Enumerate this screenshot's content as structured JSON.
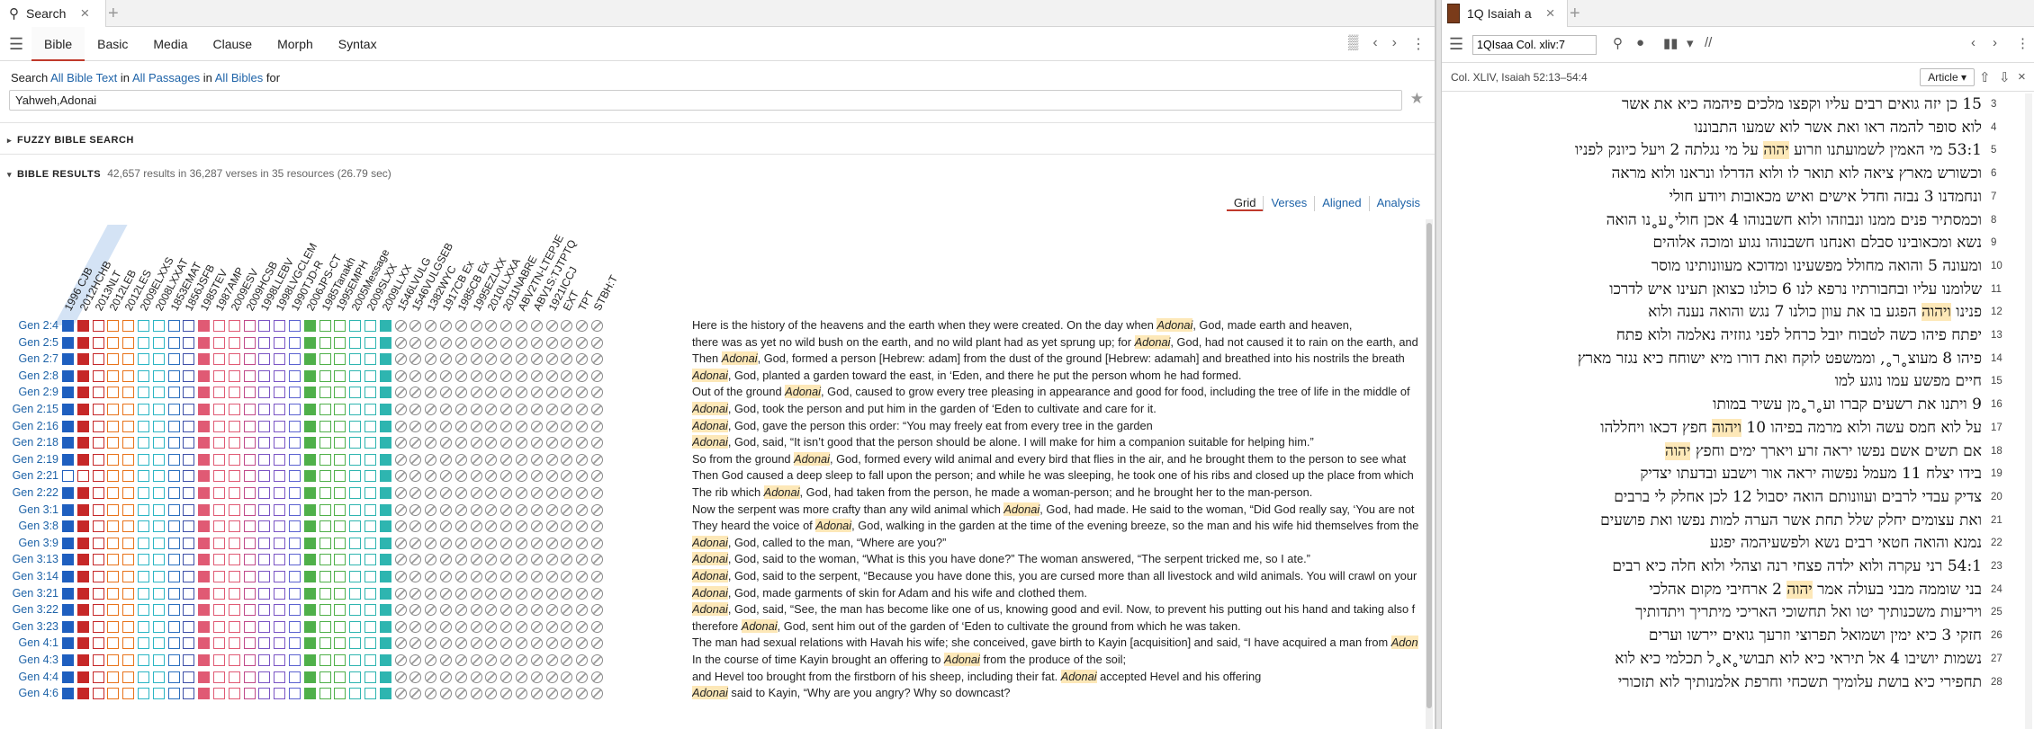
{
  "left_tab": {
    "icon": "search-icon",
    "label": "Search"
  },
  "left_menu": [
    "Bible",
    "Basic",
    "Media",
    "Clause",
    "Morph",
    "Syntax"
  ],
  "search_line": {
    "prefix": "Search",
    "scope1": "All Bible Text",
    "in1": "in",
    "scope2": "All Passages",
    "in2": "in",
    "scope3": "All Bibles",
    "for": "for"
  },
  "query": "Yahweh,Adonai",
  "fuzzy_label": "FUZZY BIBLE SEARCH",
  "results_label": "BIBLE RESULTS",
  "results_meta": "42,657 results in 36,287 verses in 35 resources (26.79 sec)",
  "view_tabs": [
    "Grid",
    "Verses",
    "Aligned",
    "Analysis"
  ],
  "columns": [
    "1996 CJB",
    "2012HCHB",
    "2013NLT",
    "2012LEB",
    "2012LES",
    "2009ELXXS",
    "2008LXXAT",
    "1853EMAT",
    "1856JSFB",
    "1985TEV",
    "1987AMP",
    "2009ESV",
    "2009HCSB",
    "1998LLEBV",
    "1998LVGCLEM",
    "1990TJD-R",
    "2006JPS-CT",
    "1985Tanakh",
    "1995EMPH",
    "2005Message",
    "2009SLXX",
    "2009LLXX",
    "1546LVULG",
    "1546VULGSEB",
    "1382WYC",
    "1917CB Ex",
    "1985CB Ex",
    "1995EZLXX",
    "2010LLXXA",
    "2011NABRE",
    "ABV2TN-LTEPJE",
    "ABV1S:TJTPTQ",
    "1921ICCJ",
    "EXT",
    "TPT",
    "STBH:T"
  ],
  "palette": [
    "#1f5fbf",
    "#c62828",
    "#c62828",
    "#e8731a",
    "#e8731a",
    "#2bb5c4",
    "#2bb5c4",
    "#2a6fbf",
    "#3d4fa8",
    "#e05a74",
    "#e05a74",
    "#e05a74",
    "#c04a8a",
    "#7a55c4",
    "#7a55c4",
    "#5b62d0",
    "#4fb04a",
    "#4fb04a",
    "#4fb04a",
    "#2eb5b0",
    "#2eb5b0",
    "#2eb5b0",
    "#888888",
    "#888888",
    "#888888",
    "#888888",
    "#888888",
    "#888888",
    "#888888",
    "#888888",
    "#888888",
    "#888888",
    "#888888",
    "#888888",
    "#888888",
    "#888888"
  ],
  "rows": [
    {
      "ref": "Gen 2:4",
      "pre": "Here is the history of the heavens and the earth when they were created. On the day when ",
      "hl": "Adonai",
      "post": ", God, made earth and heaven,"
    },
    {
      "ref": "Gen 2:5",
      "pre": "there was as yet no wild bush on the earth, and no wild plant had as yet sprung up; for ",
      "hl": "Adonai",
      "post": ", God, had not caused it to rain on the earth, and"
    },
    {
      "ref": "Gen 2:7",
      "pre": "Then ",
      "hl": "Adonai",
      "post": ", God, formed a person [Hebrew: adam] from the dust of the ground [Hebrew: adamah] and breathed into his nostrils the breath"
    },
    {
      "ref": "Gen 2:8",
      "pre": "",
      "hl": "Adonai",
      "post": ", God, planted a garden toward the east, in ‘Eden, and there he put the person whom he had formed."
    },
    {
      "ref": "Gen 2:9",
      "pre": "Out of the ground ",
      "hl": "Adonai",
      "post": ", God, caused to grow every tree pleasing in appearance and good for food, including the tree of life in the middle of"
    },
    {
      "ref": "Gen 2:15",
      "pre": "",
      "hl": "Adonai",
      "post": ", God, took the person and put him in the garden of ‘Eden to cultivate and care for it."
    },
    {
      "ref": "Gen 2:16",
      "pre": "",
      "hl": "Adonai",
      "post": ", God, gave the person this order: “You may freely eat from every tree in the garden"
    },
    {
      "ref": "Gen 2:18",
      "pre": "",
      "hl": "Adonai",
      "post": ", God, said, “It isn’t good that the person should be alone. I will make for him a companion suitable for helping him.”"
    },
    {
      "ref": "Gen 2:19",
      "pre": "So from the ground ",
      "hl": "Adonai",
      "post": ", God, formed every wild animal and every bird that flies in the air, and he brought them to the person to see what"
    },
    {
      "ref": "Gen 2:21",
      "pre": "Then God caused a deep sleep to fall upon the person; and while he was sleeping, he took one of his ribs and closed up the place from which",
      "hl": "",
      "post": ""
    },
    {
      "ref": "Gen 2:22",
      "pre": "The rib which ",
      "hl": "Adonai",
      "post": ", God, had taken from the person, he made a woman-person; and he brought her to the man-person."
    },
    {
      "ref": "Gen 3:1",
      "pre": "Now the serpent was more crafty than any wild animal which ",
      "hl": "Adonai",
      "post": ", God, had made. He said to the woman, “Did God really say, ‘You are not"
    },
    {
      "ref": "Gen 3:8",
      "pre": "They heard the voice of ",
      "hl": "Adonai",
      "post": ", God, walking in the garden at the time of the evening breeze, so the man and his wife hid themselves from the"
    },
    {
      "ref": "Gen 3:9",
      "pre": "",
      "hl": "Adonai",
      "post": ", God, called to the man, “Where are you?”"
    },
    {
      "ref": "Gen 3:13",
      "pre": "",
      "hl": "Adonai",
      "post": ", God, said to the woman, “What is this you have done?” The woman answered, “The serpent tricked me, so I ate.”"
    },
    {
      "ref": "Gen 3:14",
      "pre": "",
      "hl": "Adonai",
      "post": ", God, said to the serpent, “Because you have done this, you are cursed more than all livestock and wild animals. You will crawl on your"
    },
    {
      "ref": "Gen 3:21",
      "pre": "",
      "hl": "Adonai",
      "post": ", God, made garments of skin for Adam and his wife and clothed them."
    },
    {
      "ref": "Gen 3:22",
      "pre": "",
      "hl": "Adonai",
      "post": ", God, said, “See, the man has become like one of us, knowing good and evil. Now, to prevent his putting out his hand and taking also f"
    },
    {
      "ref": "Gen 3:23",
      "pre": "therefore ",
      "hl": "Adonai",
      "post": ", God, sent him out of the garden of ‘Eden to cultivate the ground from which he was taken."
    },
    {
      "ref": "Gen 4:1",
      "pre": "The man had sexual relations with Havah his wife; she conceived, gave birth to Kayin [acquisition] and said, “I have acquired a man from ",
      "hl": "Adon",
      "post": ""
    },
    {
      "ref": "Gen 4:3",
      "pre": "In the course of time Kayin brought an offering to ",
      "hl": "Adonai",
      "post": " from the produce of the soil;"
    },
    {
      "ref": "Gen 4:4",
      "pre": "and Hevel too brought from the firstborn of his sheep, including their fat. ",
      "hl": "Adonai",
      "post": " accepted Hevel and his offering"
    },
    {
      "ref": "Gen 4:6",
      "pre": "",
      "hl": "Adonai",
      "post": " said to Kayin, “Why are you angry? Why so downcast?"
    }
  ],
  "right_tab": {
    "label": "1Q Isaiah a"
  },
  "ref_value": "1QIsaa Col. xliv:7",
  "location": "Col. XLIV, Isaiah 52:13–54:4",
  "article_btn": "Article",
  "hebrew_lines": [
    {
      "n": "3",
      "pre": "15 כן יזה גואים רבים עליו וקפצו מלכים פיהמה כיא את אשר",
      "hl": "",
      "post": ""
    },
    {
      "n": "4",
      "pre": "לוא סופר להמה ראו ואת אשר לוא שמעו התבוננו",
      "hl": "",
      "post": ""
    },
    {
      "n": "5",
      "pre": "53:1 מי האמין לשמועתנו וזרוע ",
      "hl": "יהוה",
      "post": " על מי נגלתה 2 ויעל כיונק לפניו"
    },
    {
      "n": "6",
      "pre": "וכשורש מארץ ציאה לוא תואר לו ולוא הדרלו ונראנו ולוא מראה",
      "hl": "",
      "post": ""
    },
    {
      "n": "7",
      "pre": "ונחמדנו 3 נבזה וחדל אישים ואיש מכאובות ויודע חולי",
      "hl": "",
      "post": ""
    },
    {
      "n": "8",
      "pre": "וכמסתיר פנים ממנו ונבוזהו ולוא חשבנוהו 4 אכן חולי˳ע˳נו הואה",
      "hl": "",
      "post": ""
    },
    {
      "n": "9",
      "pre": "נשא ומכאובינו סבלם ואנחנו חשבנוהו נגוע ומוכה אלוהים",
      "hl": "",
      "post": ""
    },
    {
      "n": "10",
      "pre": "ומעונה 5 והואה מחולל מפשעינו ומדוכא מעוונותינו מוסר",
      "hl": "",
      "post": ""
    },
    {
      "n": "11",
      "pre": "שלומנו עליו ובחבורתיו נרפא לנו 6 כולנו כצואן תעינו איש לדרכו",
      "hl": "",
      "post": ""
    },
    {
      "n": "12",
      "pre": "פנינו ",
      "hl": "ויהוה",
      "post": " הפגע בו את עוון כולנו 7 נגש והואה נענה ולוא"
    },
    {
      "n": "13",
      "pre": "יפתח פיהו כשה לטבוח יובל כרחל לפני גוזזיה נאלמה ולוא פתח",
      "hl": "",
      "post": ""
    },
    {
      "n": "14",
      "pre": "פיהו 8 מעוצ˳ר˳, וממשפט לוקח ואת דורו מיא ישוחח כיא נגזר מארץ",
      "hl": "",
      "post": ""
    },
    {
      "n": "15",
      "pre": "חיים מפשע עמו נוגע למו",
      "hl": "",
      "post": ""
    },
    {
      "n": "16",
      "pre": "9 ויתנו את רשעים קברו וע˳ר˳מן עשיר במותו",
      "hl": "",
      "post": ""
    },
    {
      "n": "17",
      "pre": "על לוא חמס עשה ולוא מרמה בפיהו 10 ",
      "hl": "ויהוה",
      "post": " חפץ דכאו ויחללהו"
    },
    {
      "n": "18",
      "pre": "אם תשים אשם נפשו יראה זרע ויארך ימים וחפץ ",
      "hl": "יהוה",
      "post": ""
    },
    {
      "n": "19",
      "pre": "בידו יצלח 11 מעמל נפשוה יראה אור וישבע ובדעתו יצדיק",
      "hl": "",
      "post": ""
    },
    {
      "n": "20",
      "pre": "צדיק עבדי לרבים ועוונותם הואה יסבול 12 לכן אחלק לי ברבים",
      "hl": "",
      "post": ""
    },
    {
      "n": "21",
      "pre": "ואת עצומים יחלק שלל תחת אשר הערה למות נפשו ואת פושעים",
      "hl": "",
      "post": ""
    },
    {
      "n": "22",
      "pre": "נמנא והואה חטאי רבים נשא ולפשעיהמה יפגע",
      "hl": "",
      "post": ""
    },
    {
      "n": "23",
      "pre": "54:1 רני עקרה ולוא ילדה פצחי רנה וצהלי ולוא חלה כיא רבים",
      "hl": "",
      "post": ""
    },
    {
      "n": "24",
      "pre": "בני שוממה מבני בעולה אמר ",
      "hl": "יהוה",
      "post": " 2 ארחיבי מקום אהלכי"
    },
    {
      "n": "25",
      "pre": "ויריעות משכנותיך יטו ואל תחשוכי האריכי מיתריך ויתדותיך",
      "hl": "",
      "post": ""
    },
    {
      "n": "26",
      "pre": "חזקי 3 כיא ימין ושמואל תפרוצי וזרעך גואים יירשו וערים",
      "hl": "",
      "post": ""
    },
    {
      "n": "27",
      "pre": "נשמות יושיבו 4 אל תיראי כיא לוא תבושי˳א˳ל תכלמי כיא לוא",
      "hl": "",
      "post": ""
    },
    {
      "n": "28",
      "pre": "תחפירי כיא בושת עלומיך תשכחי וחרפת אלמנותיך לוא תזכורי",
      "hl": "",
      "post": ""
    }
  ]
}
